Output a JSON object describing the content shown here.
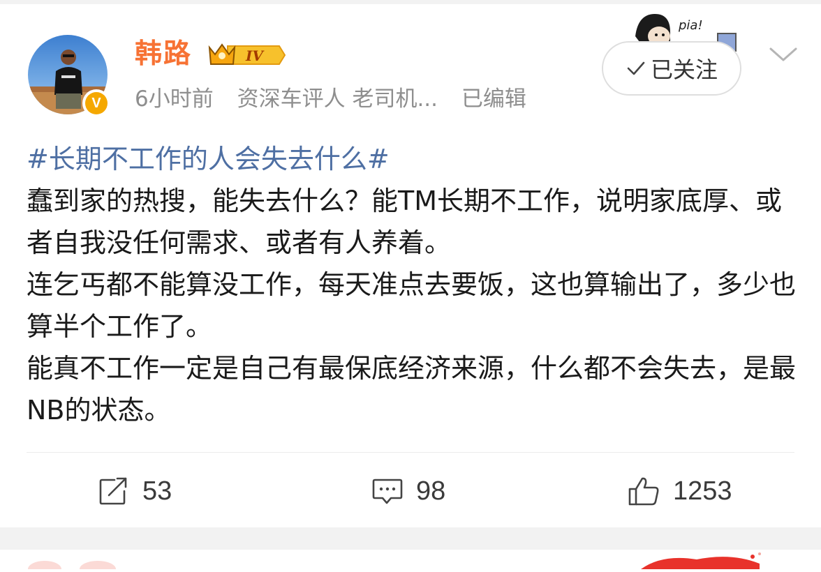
{
  "user": {
    "name": "韩路",
    "level_badge": "IV",
    "verified_mark": "V"
  },
  "meta": {
    "time": "6小时前",
    "role": "资深车评人 老司机...",
    "edited": "已编辑"
  },
  "follow": {
    "label": "已关注",
    "sticker_text": "pia!"
  },
  "post": {
    "hashtag": "#长期不工作的人会失去什么#",
    "paragraphs": [
      "蠢到家的热搜，能失去什么？能TM长期不工作，说明家底厚、或者自我没任何需求、或者有人养着。",
      "连乞丐都不能算没工作，每天准点去要饭，这也算输出了，多少也算半个工作了。",
      "能真不工作一定是自己有最保底经济来源，什么都不会失去，是最NB的状态。"
    ]
  },
  "actions": {
    "repost": "53",
    "comment": "98",
    "like": "1253"
  },
  "colors": {
    "username": "#f77234",
    "hashtag": "#4e6fa3",
    "meta": "#8e8e8e",
    "verified": "#f5a800",
    "background_band": "#f2f2f2"
  },
  "icons": [
    "verified-icon",
    "vip-crown-icon",
    "check-icon",
    "chevron-down-icon",
    "repost-icon",
    "comment-icon",
    "like-icon"
  ]
}
